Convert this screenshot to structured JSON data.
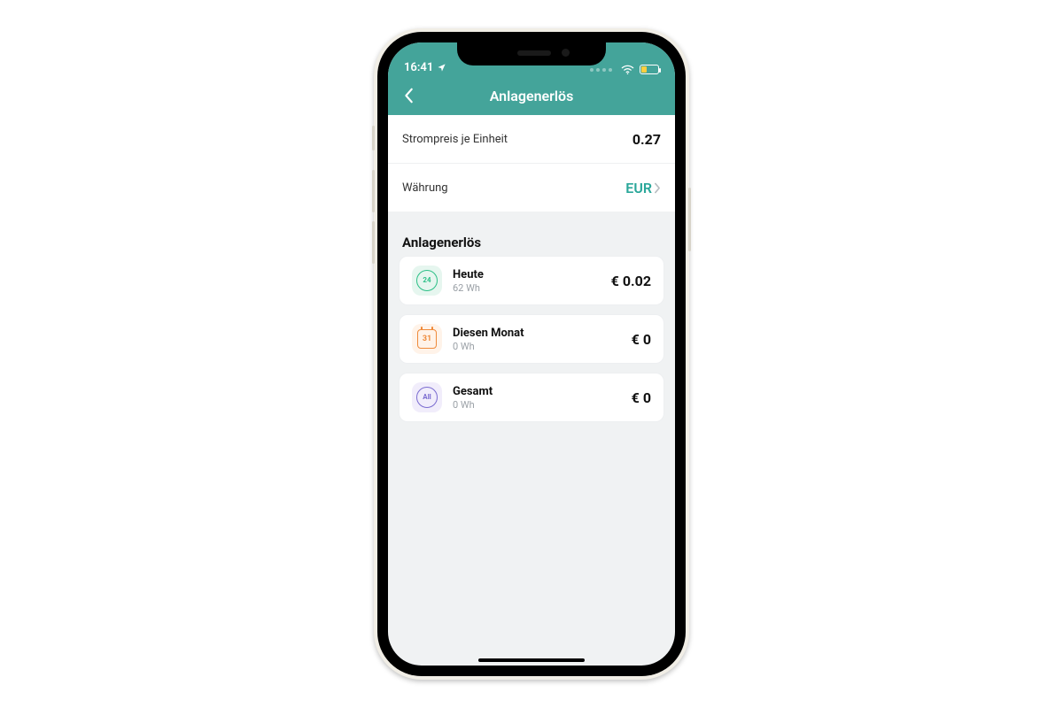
{
  "status": {
    "time": "16:41"
  },
  "header": {
    "title": "Anlagenerlös"
  },
  "settings": {
    "price_label": "Strompreis je Einheit",
    "price_value": "0.27",
    "currency_label": "Währung",
    "currency_value": "EUR"
  },
  "section": {
    "title": "Anlagenerlös"
  },
  "cards": {
    "today": {
      "icon": "24",
      "title": "Heute",
      "sub": "62 Wh",
      "value": "€ 0.02"
    },
    "month": {
      "icon": "31",
      "title": "Diesen Monat",
      "sub": "0 Wh",
      "value": "€ 0"
    },
    "total": {
      "icon": "All",
      "title": "Gesamt",
      "sub": "0 Wh",
      "value": "€ 0"
    }
  }
}
